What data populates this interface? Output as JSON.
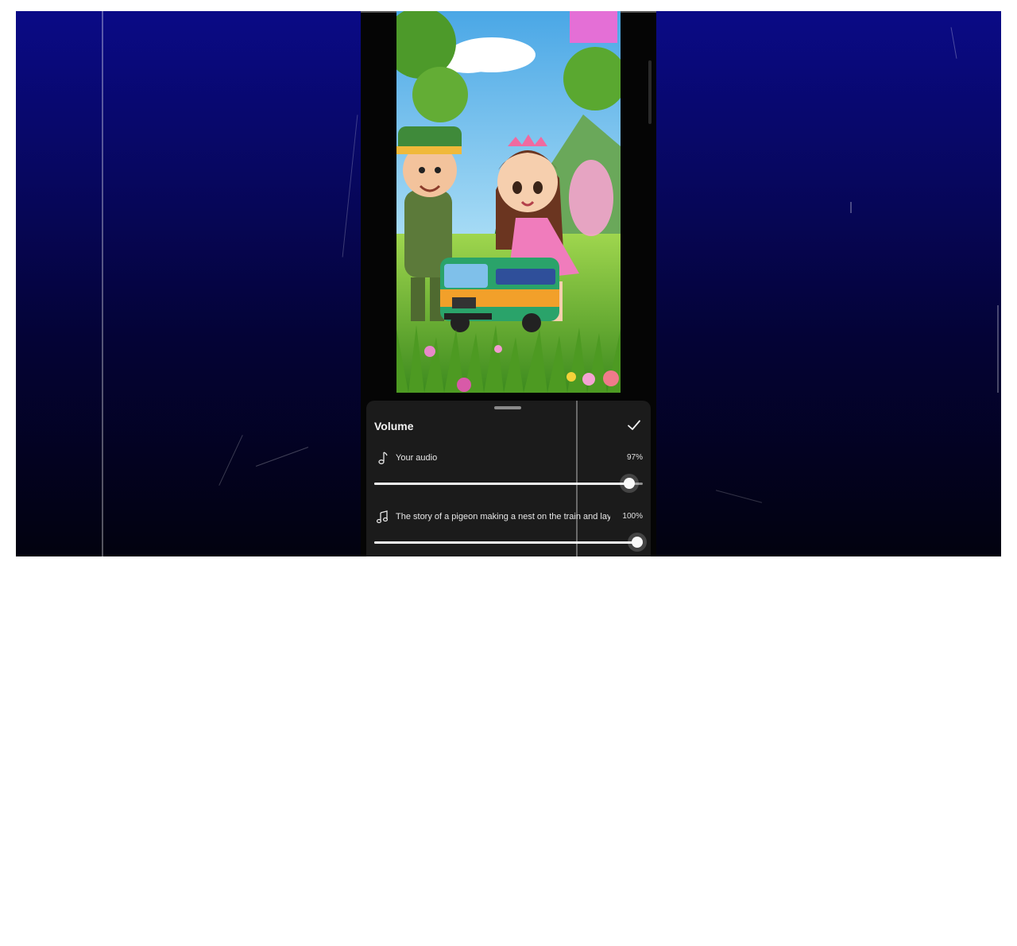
{
  "panel": {
    "title": "Volume",
    "confirm_icon": "check-icon"
  },
  "tracks": [
    {
      "icon": "music-note-icon",
      "label": "Your audio",
      "value_text": "97%",
      "level": 0.97
    },
    {
      "icon": "music-notes-icon",
      "label": "The story of a pigeon making a nest on the train and layin",
      "value_text": "100%",
      "level": 1.0
    }
  ],
  "colors": {
    "background_top": "#0a0a86",
    "background_bottom": "#02020f",
    "sheet": "#1b1b1b",
    "slider_fill": "#f2f2f2",
    "slider_track": "#8c8c8c"
  }
}
